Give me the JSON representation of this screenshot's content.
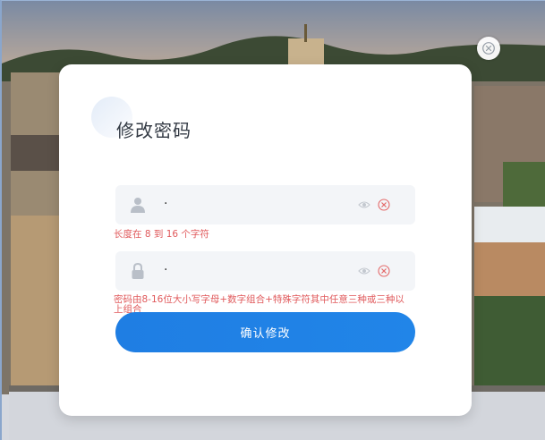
{
  "modal": {
    "title": "修改密码",
    "close_icon": "close-icon",
    "account_field": {
      "icon": "user-icon",
      "value": "·",
      "eye_icon": "eye-icon",
      "clear_icon": "clear-circle-icon",
      "hint": "长度在 8 到 16 个字符"
    },
    "password_field": {
      "icon": "lock-icon",
      "value": "·",
      "eye_icon": "eye-icon",
      "clear_icon": "clear-circle-icon",
      "hint_line1": "密码由8-16位大小写字母+数字组合+特殊字符其中任意三种或三种以",
      "hint_line2": "上组合"
    },
    "submit_label": "确认修改"
  },
  "colors": {
    "accent": "#1f7ee3",
    "error": "#e0595b",
    "field_bg": "#f3f5f8"
  }
}
